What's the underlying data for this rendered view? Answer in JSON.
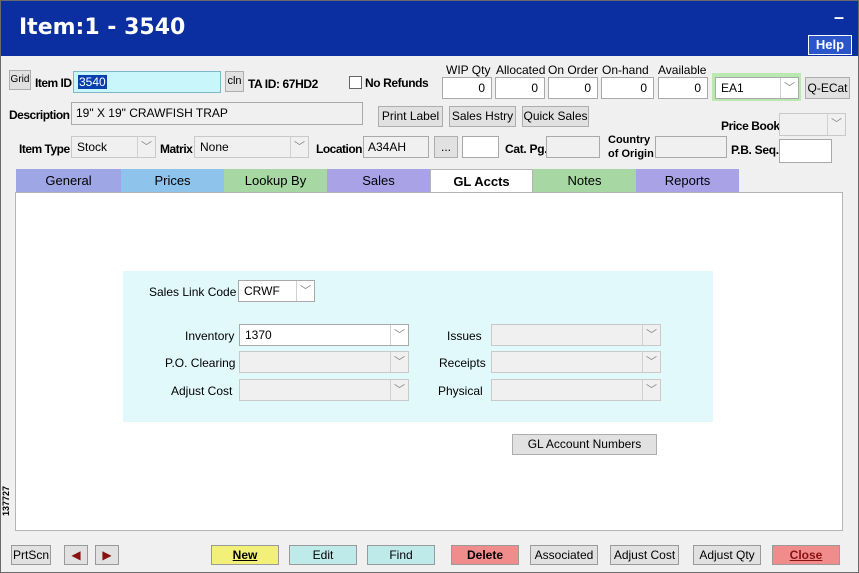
{
  "window": {
    "title": "Item:1 - 3540",
    "minimize": "–",
    "help": "Help"
  },
  "header": {
    "grid_btn": "Grid",
    "item_id_label": "Item ID",
    "item_id_value": "3540",
    "cln_btn": "cln",
    "ta_id": "TA ID: 67HD2",
    "no_refunds": "No Refunds",
    "description_label": "Description",
    "description_value": "19\" X 19\" CRAWFISH TRAP",
    "print_label_btn": "Print Label",
    "sales_history_btn": "Sales Hstry",
    "quick_sales_btn": "Quick Sales",
    "qty": {
      "wip_label": "WIP Qty",
      "wip": "0",
      "allocated_label": "Allocated",
      "allocated": "0",
      "on_order_label": "On Order",
      "on_order": "0",
      "on_hand_label": "On-hand",
      "on_hand": "0",
      "available_label": "Available",
      "available": "0"
    },
    "uom_value": "EA1",
    "qecat_btn": "Q-ECat",
    "price_book_label": "Price Book",
    "item_type_label": "Item Type",
    "item_type_value": "Stock",
    "matrix_label": "Matrix",
    "matrix_value": "None",
    "location_label": "Location",
    "location_value": "A34AH",
    "ellipsis_btn": "...",
    "cat_pg_label": "Cat. Pg.",
    "country_label_1": "Country",
    "country_label_2": "of Origin",
    "pb_seq_label": "P.B. Seq."
  },
  "tabs": [
    {
      "label": "General",
      "color": "#9fa6e6"
    },
    {
      "label": "Prices",
      "color": "#8ec4ec"
    },
    {
      "label": "Lookup By",
      "color": "#a7d8a3"
    },
    {
      "label": "Sales",
      "color": "#a9a2e6"
    },
    {
      "label": "GL Accts",
      "color": "#ffffff"
    },
    {
      "label": "Notes",
      "color": "#a7d8a3"
    },
    {
      "label": "Reports",
      "color": "#a9a2e6"
    }
  ],
  "gl": {
    "sales_link_code_label": "Sales Link Code",
    "sales_link_code_value": "CRWF",
    "inventory_label": "Inventory",
    "inventory_value": "1370",
    "po_clearing_label": "P.O. Clearing",
    "adjust_cost_label": "Adjust Cost",
    "issues_label": "Issues",
    "receipts_label": "Receipts",
    "physical_label": "Physical",
    "gl_numbers_btn": "GL Account Numbers"
  },
  "side_id": "137727",
  "footer": {
    "prtscn": "PrtScn",
    "prev": "◀",
    "next": "▶",
    "new": "New",
    "edit": "Edit",
    "find": "Find",
    "delete": "Delete",
    "associated": "Associated",
    "adjust_cost": "Adjust Cost",
    "adjust_qty": "Adjust Qty",
    "close": "Close"
  }
}
